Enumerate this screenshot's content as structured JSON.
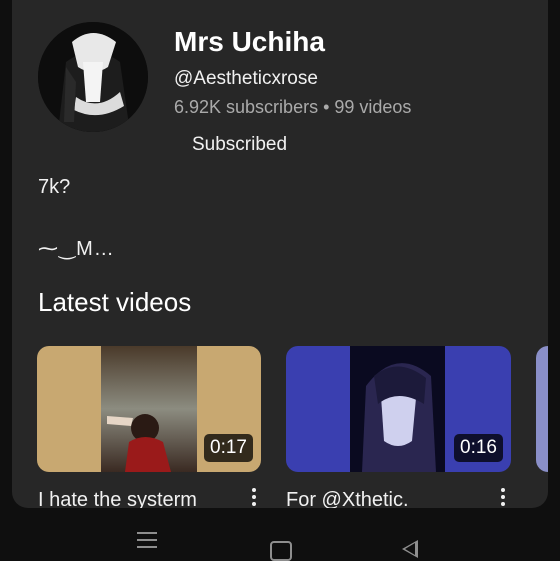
{
  "channel": {
    "name": "Mrs Uchiha",
    "handle": "@Aestheticxrose",
    "stats": "6.92K subscribers • 99 videos",
    "subscribe_label": "Subscribed"
  },
  "description": {
    "line1": "7k?",
    "line2": "⁓‿M…"
  },
  "latest": {
    "title": "Latest videos",
    "videos": [
      {
        "title": "I hate the systerm",
        "duration": "0:17"
      },
      {
        "title": "For @Xthetic.",
        "duration": "0:16"
      }
    ]
  },
  "colors": {
    "background": "#0f0f0f",
    "sheet": "#272727",
    "text": "#f1f1f1",
    "secondary_text": "#aaaaaa"
  },
  "icons": {
    "more": "vertical-dots-icon",
    "nav_menu": "recent-apps-icon",
    "nav_home": "home-icon",
    "nav_back": "back-icon"
  }
}
